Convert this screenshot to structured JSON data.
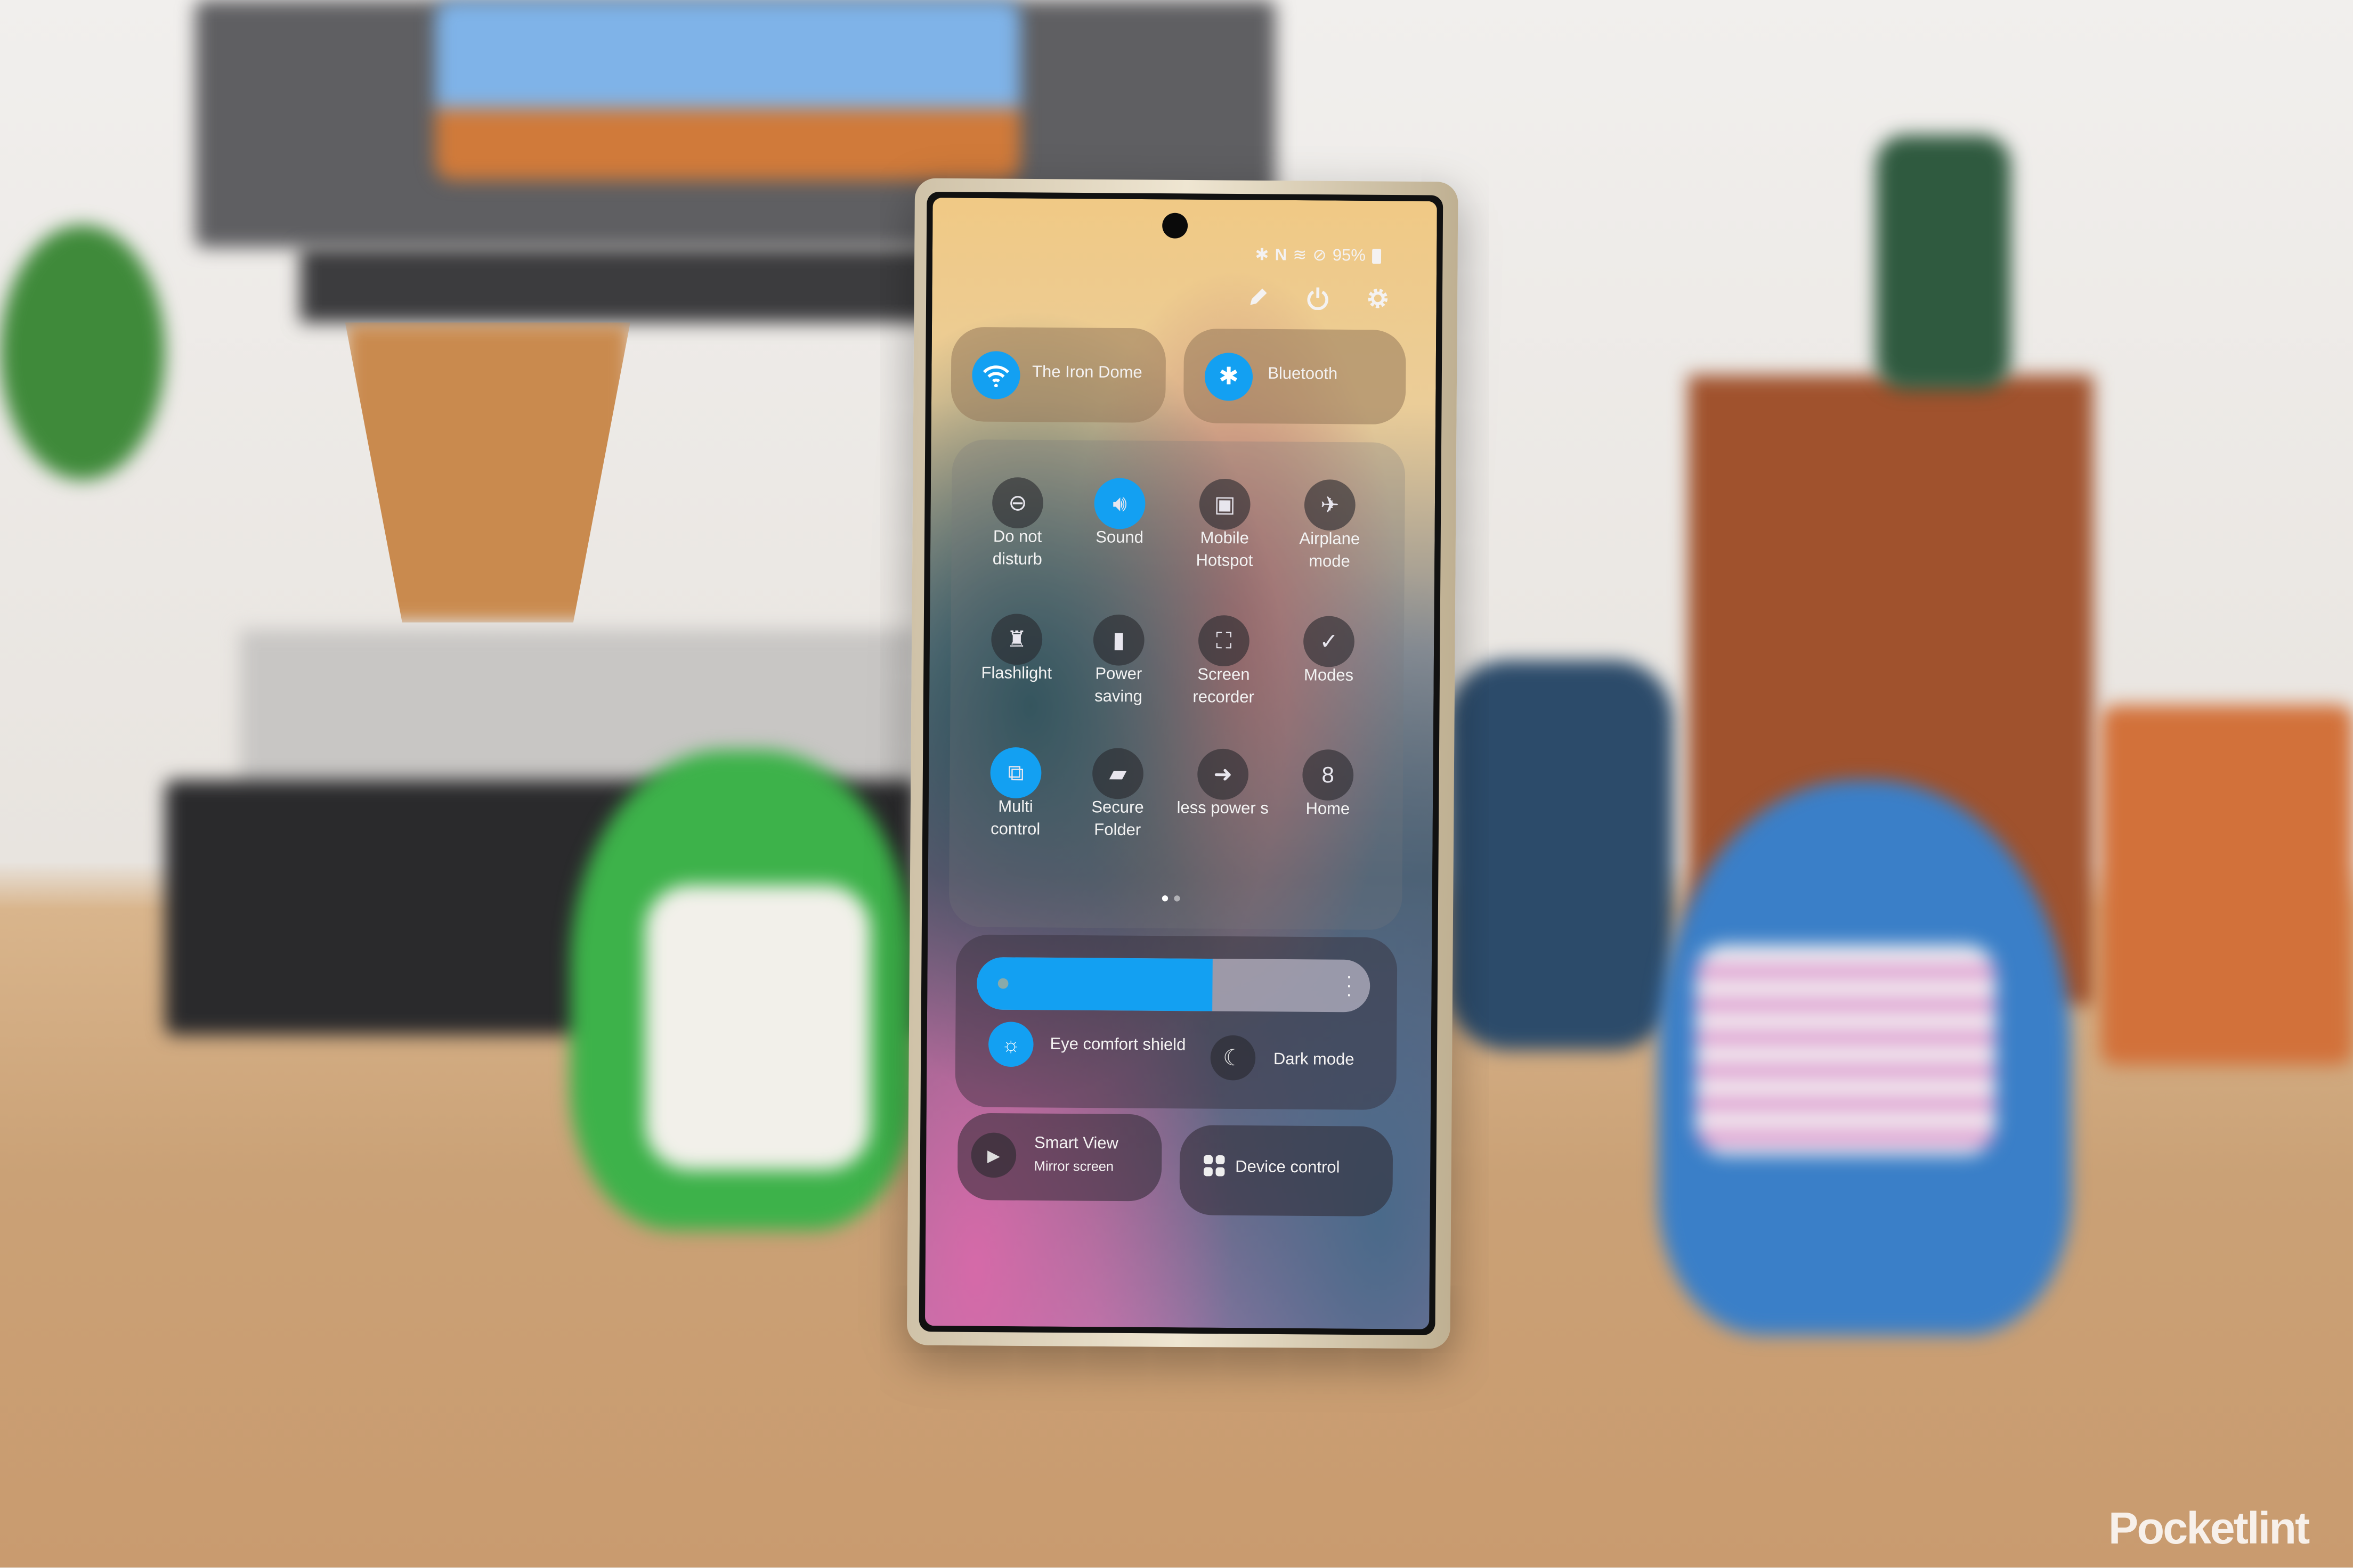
{
  "status_bar": {
    "battery": "95%",
    "icons": [
      "bluetooth-icon",
      "nfc-icon",
      "wifi-6e-icon",
      "do-not-disturb-icon",
      "battery-icon"
    ]
  },
  "header_actions": [
    {
      "icon": "pencil-icon"
    },
    {
      "icon": "power-icon"
    },
    {
      "icon": "gear-icon"
    }
  ],
  "big_tiles": [
    {
      "label": "The Iron Dome",
      "icon": "wifi-icon",
      "active": true
    },
    {
      "label": "Bluetooth",
      "icon": "bluetooth-icon",
      "active": true
    }
  ],
  "quick_tiles": [
    {
      "label": "Do not disturb",
      "l1": "Do not",
      "l2": "disturb",
      "icon": "minus-circle-icon",
      "active": false
    },
    {
      "label": "Sound",
      "l1": "Sound",
      "l2": "",
      "icon": "speaker-icon",
      "active": true
    },
    {
      "label": "Mobile Hotspot",
      "l1": "Mobile",
      "l2": "Hotspot",
      "icon": "hotspot-icon",
      "active": false
    },
    {
      "label": "Airplane mode",
      "l1": "Airplane",
      "l2": "mode",
      "icon": "airplane-icon",
      "active": false
    },
    {
      "label": "Flashlight",
      "l1": "Flashlight",
      "l2": "",
      "icon": "flashlight-icon",
      "active": false
    },
    {
      "label": "Power saving",
      "l1": "Power",
      "l2": "saving",
      "icon": "battery-leaf-icon",
      "active": false
    },
    {
      "label": "Screen recorder",
      "l1": "Screen",
      "l2": "recorder",
      "icon": "screen-record-icon",
      "active": false
    },
    {
      "label": "Modes",
      "l1": "Modes",
      "l2": "",
      "icon": "modes-check-icon",
      "active": false
    },
    {
      "label": "Multi control",
      "l1": "Multi",
      "l2": "control",
      "icon": "multi-control-icon",
      "active": true
    },
    {
      "label": "Secure Folder",
      "l1": "Secure",
      "l2": "Folder",
      "icon": "secure-folder-icon",
      "active": false
    },
    {
      "label": "less power s",
      "l1": "less power s",
      "l2": "",
      "icon": "wireless-powershare-icon",
      "active": false
    },
    {
      "label": "Home",
      "l1": "Home",
      "l2": "",
      "icon": "home-dragon-icon",
      "active": false
    }
  ],
  "page_indicator": {
    "pages": 2,
    "current": 1
  },
  "brightness": {
    "level_percent": 60,
    "menu_icon": "more-vertical-icon"
  },
  "display_toggles": [
    {
      "label": "Eye comfort shield",
      "icon": "eye-comfort-icon",
      "active": true
    },
    {
      "label": "Dark mode",
      "icon": "moon-icon",
      "active": false
    }
  ],
  "bottom_tiles": {
    "smart_view": {
      "title": "Smart View",
      "subtitle": "Mirror screen",
      "icon": "smart-view-icon"
    },
    "device_control": {
      "label": "Device control",
      "icon": "device-control-icon"
    }
  },
  "colors": {
    "accent": "#13a0f2"
  },
  "watermark": "Pocketlint"
}
